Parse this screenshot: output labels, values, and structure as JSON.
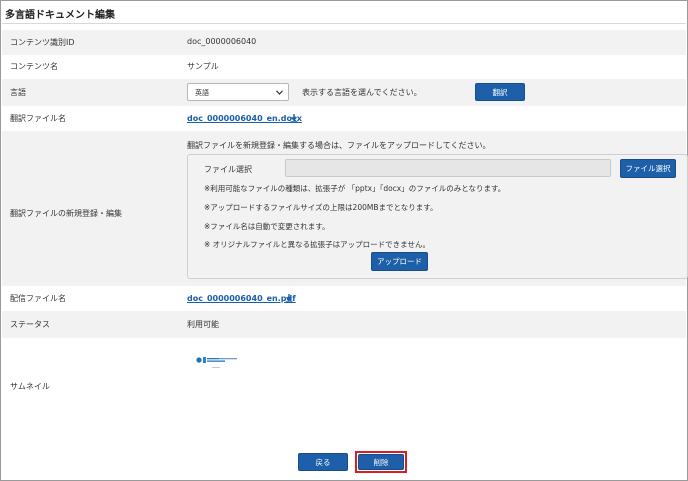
{
  "page": {
    "title": "多言語ドキュメント編集"
  },
  "rows": {
    "content_id": {
      "label": "コンテンツ識別ID",
      "value": "doc_0000006040"
    },
    "content_name": {
      "label": "コンテンツ名",
      "value": "サンプル"
    },
    "language": {
      "label": "言語",
      "selected": "英語",
      "hint": "表示する言語を選んでください。",
      "translate_button": "翻訳"
    },
    "translation_file": {
      "label": "翻訳ファイル名",
      "file": "doc_0000006040_en.docx"
    },
    "translation_upload": {
      "label": "翻訳ファイルの新規登録・編集",
      "instruction": "翻訳ファイルを新規登録・編集する場合は、ファイルをアップロードしてください。",
      "file_select_label": "ファイル選択",
      "file_select_button": "ファイル選択",
      "notes": [
        "※利用可能なファイルの種類は、拡張子が 「pptx」「docx」のファイルのみとなります。",
        "※アップロードするファイルサイズの上限は200MBまでとなります。",
        "※ファイル名は自動で変更されます。",
        "※ オリジナルファイルと異なる拡張子はアップロードできません。"
      ],
      "upload_button": "アップロード"
    },
    "delivery_file": {
      "label": "配信ファイル名",
      "file": "doc_0000006040_en.pdf"
    },
    "status": {
      "label": "ステータス",
      "value": "利用可能"
    },
    "thumbnail": {
      "label": "サムネイル"
    }
  },
  "footer": {
    "back_button": "戻る",
    "delete_button": "削除"
  },
  "colors": {
    "primary": "#1d5fa8",
    "link": "#1a5fa8",
    "highlight": "#d81f26",
    "row_shade": "#f2f2f2"
  },
  "icons": [
    "download-icon",
    "chevron-down-icon",
    "thumbnail-image"
  ]
}
